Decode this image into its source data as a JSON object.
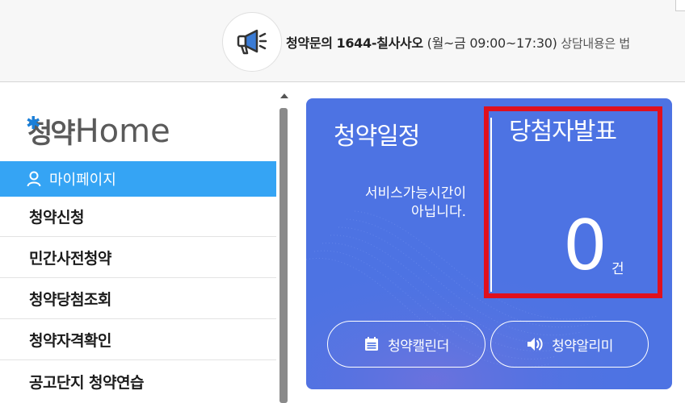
{
  "notice": {
    "prefix": "청약문의",
    "phone": "1644-칠사사오",
    "hours": "(월~금 09:00~17:30)",
    "extra": "상담내용은 법"
  },
  "sidebar": {
    "logo_ko": "청약",
    "logo_en": "Home",
    "active_item": "마이페이지",
    "items": [
      {
        "label": "청약신청"
      },
      {
        "label": "민간사전청약"
      },
      {
        "label": "청약당첨조회"
      },
      {
        "label": "청약자격확인"
      },
      {
        "label": "공고단지 청약연습"
      }
    ]
  },
  "card": {
    "left_title": "청약일정",
    "service_msg_line1": "서비스가능시간이",
    "service_msg_line2": "아닙니다.",
    "right_title": "당첨자발표",
    "count": "0",
    "unit": "건",
    "calendar_button": "청약캘린더",
    "alert_button": "청약알리미"
  },
  "colors": {
    "card_bg": "#4d73e3",
    "active_menu": "#35a4f4",
    "highlight": "#e0101d",
    "logo_accent": "#1a7fd9"
  }
}
